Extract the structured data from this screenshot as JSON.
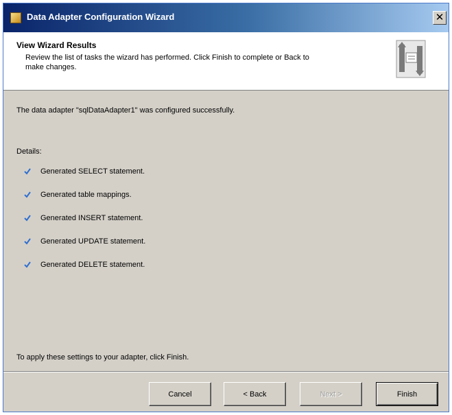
{
  "window": {
    "title": "Data Adapter Configuration Wizard",
    "close_glyph": "✕"
  },
  "header": {
    "title": "View Wizard Results",
    "description": "Review the list of tasks the wizard has performed. Click Finish to complete or Back to make changes."
  },
  "main": {
    "success_message": "The data adapter \"sqlDataAdapter1\" was configured successfully.",
    "details_label": "Details:",
    "tasks": [
      {
        "label": "Generated SELECT statement."
      },
      {
        "label": "Generated table mappings."
      },
      {
        "label": "Generated INSERT statement."
      },
      {
        "label": "Generated UPDATE statement."
      },
      {
        "label": "Generated DELETE statement."
      }
    ],
    "apply_message": "To apply these settings to your adapter, click Finish."
  },
  "buttons": {
    "cancel": "Cancel",
    "back": "< Back",
    "next": "Next >",
    "finish": "Finish"
  },
  "colors": {
    "check": "#2f6fd0",
    "title_bar": "#0a246a"
  }
}
